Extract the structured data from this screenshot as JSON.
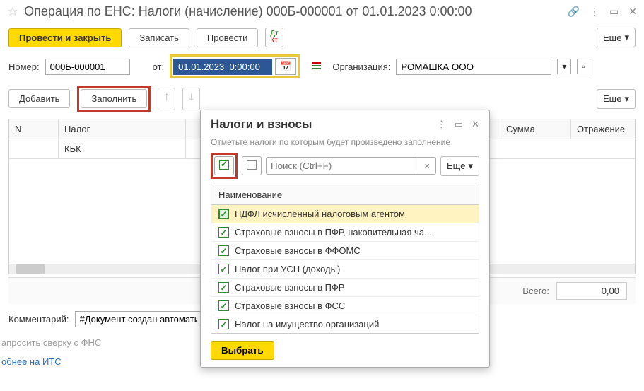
{
  "title": "Операция по ЕНС: Налоги (начисление) 000Б-000001 от 01.01.2023 0:00:00",
  "toolbar": {
    "post_close": "Провести и закрыть",
    "save": "Записать",
    "post": "Провести",
    "more": "Еще"
  },
  "form": {
    "number_label": "Номер:",
    "number_value": "000Б-000001",
    "from_label": "от:",
    "date_value": "01.01.2023  0:00:00",
    "org_label": "Организация:",
    "org_value": "РОМАШКА ООО"
  },
  "row2": {
    "add": "Добавить",
    "fill": "Заполнить",
    "more": "Еще"
  },
  "table": {
    "col_n": "N",
    "col_tax": "Налог",
    "col_sum": "Сумма",
    "col_reflect": "Отражение",
    "sub_kbk": "КБК"
  },
  "totals": {
    "label": "Всего:",
    "value": "0,00"
  },
  "comment": {
    "label": "Комментарий:",
    "value": "#Документ создан автомати"
  },
  "faded_button": "апросить сверку с ФНС",
  "link": "обнее на ИТС",
  "popup": {
    "title": "Налоги и взносы",
    "subtitle": "Отметьте налоги по которым будет произведено заполнение",
    "search_placeholder": "Поиск (Ctrl+F)",
    "more": "Еще",
    "col_name": "Наименование",
    "items": [
      {
        "label": "НДФЛ исчисленный налоговым агентом",
        "checked": true,
        "active": true
      },
      {
        "label": "Страховые взносы в ПФР, накопительная ча...",
        "checked": true,
        "active": false
      },
      {
        "label": "Страховые взносы в ФФОМС",
        "checked": true,
        "active": false
      },
      {
        "label": "Налог при УСН (доходы)",
        "checked": true,
        "active": false
      },
      {
        "label": "Страховые взносы в ПФР",
        "checked": true,
        "active": false
      },
      {
        "label": "Страховые взносы в ФСС",
        "checked": true,
        "active": false
      },
      {
        "label": "Налог на имущество организаций",
        "checked": true,
        "active": false
      }
    ],
    "select_label": "Выбрать"
  }
}
